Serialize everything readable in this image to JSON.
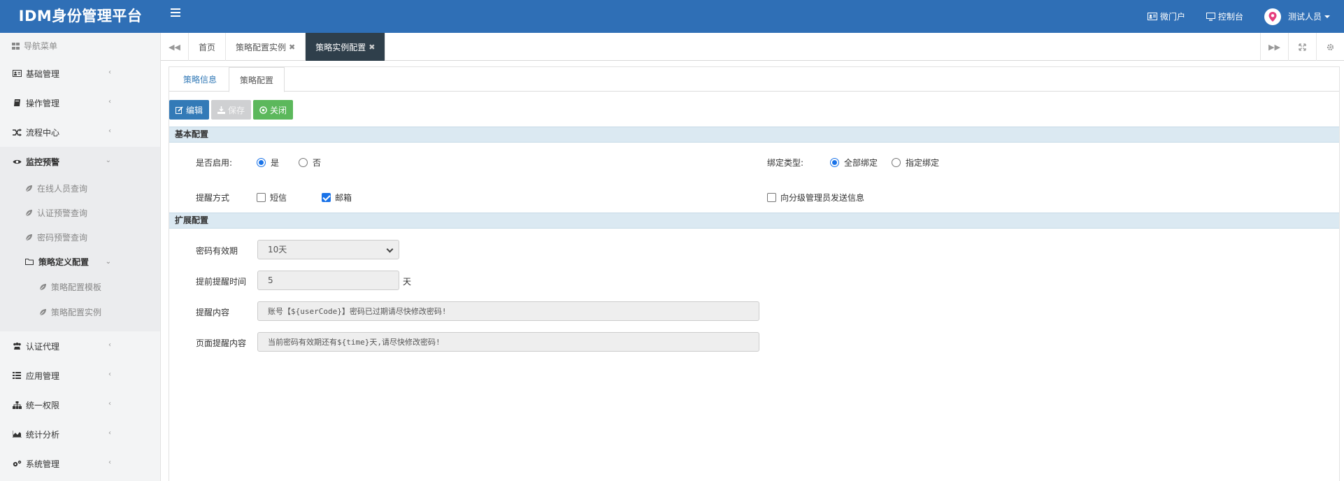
{
  "header": {
    "brand": "IDM身份管理平台",
    "links": {
      "portal": "微门户",
      "console": "控制台",
      "user": "测试人员"
    }
  },
  "sidebar": {
    "title": "导航菜单",
    "items": [
      {
        "label": "基础管理",
        "icon": "id-card-icon"
      },
      {
        "label": "操作管理",
        "icon": "book-icon"
      },
      {
        "label": "流程中心",
        "icon": "random-icon"
      },
      {
        "label": "监控预警",
        "icon": "eye-icon"
      }
    ],
    "monitor_sub": [
      {
        "label": "在线人员查询"
      },
      {
        "label": "认证预警查询"
      },
      {
        "label": "密码预警查询"
      },
      {
        "label": "策略定义配置"
      }
    ],
    "policy_sub": [
      {
        "label": "策略配置模板"
      },
      {
        "label": "策略配置实例"
      }
    ],
    "items2": [
      {
        "label": "认证代理"
      },
      {
        "label": "应用管理"
      },
      {
        "label": "统一权限"
      },
      {
        "label": "统计分析"
      },
      {
        "label": "系统管理"
      }
    ]
  },
  "tabs": [
    {
      "label": "首页"
    },
    {
      "label": "策略配置实例"
    },
    {
      "label": "策略实例配置"
    }
  ],
  "subtabs": {
    "info": "策略信息",
    "config": "策略配置"
  },
  "buttons": {
    "edit": "编辑",
    "save": "保存",
    "close": "关闭"
  },
  "basic": {
    "section": "基本配置",
    "enable_label": "是否启用:",
    "enable_yes": "是",
    "enable_no": "否",
    "bind_label": "绑定类型:",
    "bind_all": "全部绑定",
    "bind_specific": "指定绑定",
    "notify_label": "提醒方式",
    "notify_sms": "短信",
    "notify_email": "邮箱",
    "notify_admin": "向分级管理员发送信息"
  },
  "ext": {
    "section": "扩展配置",
    "validity_label": "密码有效期",
    "validity_value": "10天",
    "advance_label": "提前提醒时间",
    "advance_value": "5",
    "advance_unit": "天",
    "content_label": "提醒内容",
    "content_value": "账号【${userCode}】密码已过期请尽快修改密码!",
    "page_label": "页面提醒内容",
    "page_value": "当前密码有效期还有${time}天,请尽快修改密码!"
  },
  "colors": {
    "header": "#2f6fb6",
    "active_tab": "#2f3f4b",
    "primary": "#337ab7",
    "success": "#5cb85c"
  }
}
